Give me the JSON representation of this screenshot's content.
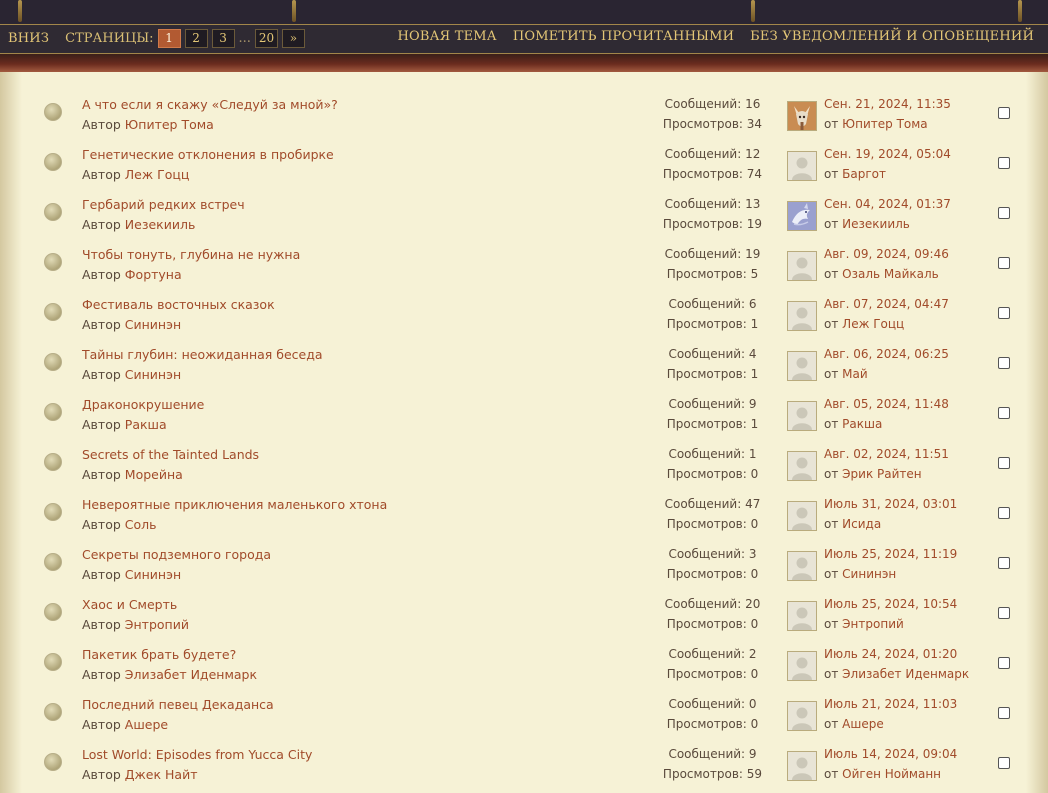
{
  "navbar": {
    "down_label": "ВНИЗ",
    "pages_label": "СТРАНИЦЫ:",
    "pages": [
      "1",
      "2",
      "3"
    ],
    "dots": "...",
    "last_page": "20",
    "next": "»",
    "new_topic": "НОВАЯ ТЕМА",
    "mark_read": "ПОМЕТИТЬ ПРОЧИТАННЫМИ",
    "no_notify": "БЕЗ УВЕДОМЛЕНИЙ И ОПОВЕЩЕНИЙ"
  },
  "labels": {
    "author_prefix": "Автор",
    "by_prefix": "от",
    "replies_prefix": "Сообщений: ",
    "views_prefix": "Просмотров: "
  },
  "topics": [
    {
      "title": "А что если я скажу «Следуй за мной»?",
      "author": "Юпитер Тома",
      "replies": "16",
      "views": "34",
      "last_date": "Сен. 21, 2024, 11:35",
      "last_by": "Юпитер Тома",
      "avatar": "fox-avatar"
    },
    {
      "title": "Генетические отклонения в пробирке",
      "author": "Леж Гоцц",
      "replies": "12",
      "views": "74",
      "last_date": "Сен. 19, 2024, 05:04",
      "last_by": "Баргот",
      "avatar": "default-avatar"
    },
    {
      "title": "Гербарий редких встреч",
      "author": "Иезекииль",
      "replies": "13",
      "views": "19",
      "last_date": "Сен. 04, 2024, 01:37",
      "last_by": "Иезекииль",
      "avatar": "dragon-avatar"
    },
    {
      "title": "Чтобы тонуть, глубина не нужна",
      "author": "Фортуна",
      "replies": "19",
      "views": "5",
      "last_date": "Авг. 09, 2024, 09:46",
      "last_by": "Озаль Майкаль",
      "avatar": "default-avatar"
    },
    {
      "title": "Фестиваль восточных сказок",
      "author": "Сининэн",
      "replies": "6",
      "views": "1",
      "last_date": "Авг. 07, 2024, 04:47",
      "last_by": "Леж Гоцц",
      "avatar": "default-avatar"
    },
    {
      "title": "Тайны глубин: неожиданная беседа",
      "author": "Сининэн",
      "replies": "4",
      "views": "1",
      "last_date": "Авг. 06, 2024, 06:25",
      "last_by": "Май",
      "avatar": "default-avatar"
    },
    {
      "title": "Драконокрушение",
      "author": "Ракша",
      "replies": "9",
      "views": "1",
      "last_date": "Авг. 05, 2024, 11:48",
      "last_by": "Ракша",
      "avatar": "default-avatar"
    },
    {
      "title": "Secrets of the Tainted Lands",
      "author": "Морейна",
      "replies": "1",
      "views": "0",
      "last_date": "Авг. 02, 2024, 11:51",
      "last_by": "Эрик Райтен",
      "avatar": "default-avatar"
    },
    {
      "title": "Невероятные приключения маленького хтона",
      "author": "Соль",
      "replies": "47",
      "views": "0",
      "last_date": "Июль 31, 2024, 03:01",
      "last_by": "Исида",
      "avatar": "default-avatar"
    },
    {
      "title": "Секреты подземного города",
      "author": "Сининэн",
      "replies": "3",
      "views": "0",
      "last_date": "Июль 25, 2024, 11:19",
      "last_by": "Сининэн",
      "avatar": "default-avatar"
    },
    {
      "title": "Хаос и Смерть",
      "author": "Энтропий",
      "replies": "20",
      "views": "0",
      "last_date": "Июль 25, 2024, 10:54",
      "last_by": "Энтропий",
      "avatar": "default-avatar"
    },
    {
      "title": "Пакетик брать будете?",
      "author": "Элизабет Иденмарк",
      "replies": "2",
      "views": "0",
      "last_date": "Июль 24, 2024, 01:20",
      "last_by": "Элизабет Иденмарк",
      "avatar": "default-avatar"
    },
    {
      "title": "Последний певец Декаданса",
      "author": "Ашере",
      "replies": "0",
      "views": "0",
      "last_date": "Июль 21, 2024, 11:03",
      "last_by": "Ашере",
      "avatar": "default-avatar"
    },
    {
      "title": "Lost World: Episodes from Yucca City",
      "author": "Джек Найт",
      "replies": "9",
      "views": "59",
      "last_date": "Июль 14, 2024, 09:04",
      "last_by": "Ойген Нойманн",
      "avatar": "default-avatar"
    }
  ]
}
